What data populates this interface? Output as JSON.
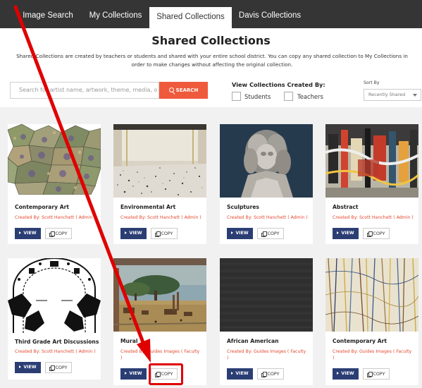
{
  "nav": {
    "tabs": [
      {
        "label": "Image Search",
        "active": false
      },
      {
        "label": "My Collections",
        "active": false
      },
      {
        "label": "Shared Collections",
        "active": true
      },
      {
        "label": "Davis Collections",
        "active": false
      }
    ]
  },
  "page": {
    "title": "Shared Collections",
    "description": "Shared Collections are created by teachers or students and shared with your entire school district. You can copy any shared collection to My Collections in order to make changes without affecting the original collection."
  },
  "search": {
    "placeholder": "Search for artist name, artwork, theme, media, o",
    "button_label": "SEARCH"
  },
  "filters": {
    "label": "View Collections Created By:",
    "options": [
      {
        "label": "Students",
        "checked": false
      },
      {
        "label": "Teachers",
        "checked": false
      }
    ]
  },
  "sort": {
    "label": "Sort By",
    "selected": "Recently Shared"
  },
  "actions": {
    "view_label": "VIEW",
    "copy_label": "COPY"
  },
  "collections": [
    {
      "title": "Contemporary Art",
      "creator": "Created By: Scott Hanchett ( Admin )",
      "image": "tessellation-pattern"
    },
    {
      "title": "Environmental Art",
      "creator": "Created By: Scott Hanchett ( Admin )",
      "image": "marble-floor-installation"
    },
    {
      "title": "Sculptures",
      "creator": "Created By: Scott Hanchett ( Admin )",
      "image": "marble-bust"
    },
    {
      "title": "Abstract",
      "creator": "Created By: Scott Hanchett ( Admin )",
      "image": "abstract-painting"
    },
    {
      "title": "Third Grade Art Discussions",
      "creator": "Created By: Scott Hanchett ( Admin )",
      "image": "floor-plan-drawing"
    },
    {
      "title": "Mural",
      "creator": "Created By: Guides Images ( Faculty )",
      "image": "savanna-mural"
    },
    {
      "title": "African American",
      "creator": "Created By: Guides Images ( Faculty )",
      "image": "dark-textured-work"
    },
    {
      "title": "Contemporary Art",
      "creator": "Created By: Guides Images ( Faculty )",
      "image": "drip-painting"
    }
  ],
  "colors": {
    "nav_bg": "#353535",
    "accent_orange": "#ef5a3c",
    "creator_red": "#e2472f",
    "view_navy": "#2b3e74",
    "annotation_red": "#e00000"
  }
}
